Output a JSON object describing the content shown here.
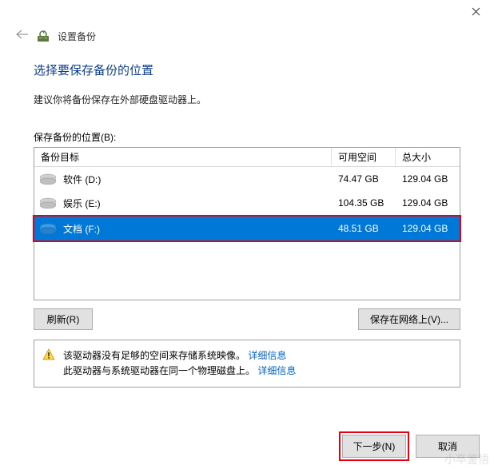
{
  "window": {
    "title": "设置备份"
  },
  "page": {
    "heading": "选择要保存备份的位置",
    "subtitle": "建议你将备份保存在外部硬盘驱动器上。",
    "list_label": "保存备份的位置(B):"
  },
  "columns": {
    "target": "备份目标",
    "free": "可用空间",
    "total": "总大小"
  },
  "drives": [
    {
      "label": "软件 (D:)",
      "free": "74.47 GB",
      "total": "129.04 GB"
    },
    {
      "label": "娱乐 (E:)",
      "free": "104.35 GB",
      "total": "129.04 GB"
    },
    {
      "label": "文档 (F:)",
      "free": "48.51 GB",
      "total": "129.04 GB"
    }
  ],
  "buttons": {
    "refresh": "刷新(R)",
    "save_network": "保存在网络上(V)...",
    "next": "下一步(N)",
    "cancel": "取消"
  },
  "warning": {
    "line1_a": "该驱动器没有足够的空间来存储系统映像。",
    "line1_link": "详细信息",
    "line2_a": "此驱动器与系统驱动器在同一个物理磁盘上。",
    "line2_link": "详细信息"
  },
  "watermark": "小卒鉴悟"
}
